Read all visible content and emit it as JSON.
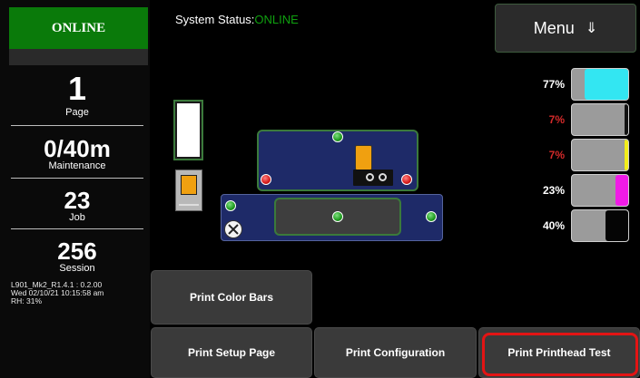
{
  "sidebar": {
    "online_label": "ONLINE",
    "page": {
      "value": "1",
      "label": "Page"
    },
    "maintenance": {
      "value": "0/40m",
      "label": "Maintenance"
    },
    "job": {
      "value": "23",
      "label": "Job"
    },
    "session": {
      "value": "256",
      "label": "Session"
    },
    "info": {
      "firmware": "L901_Mk2_R1.4.1 : 0.2.00",
      "datetime": "Wed 02/10/21 10:15:58 am",
      "humidity": "RH: 31%"
    }
  },
  "header": {
    "status_label": "System Status:",
    "status_value": "ONLINE",
    "menu_label": "Menu",
    "menu_icon": "⇓"
  },
  "ink_levels": [
    {
      "name": "cyan",
      "percent": "77%",
      "level": 0.77,
      "color": "#33e6f2",
      "text_color": "#ffffff"
    },
    {
      "name": "black",
      "percent": "7%",
      "level": 0.07,
      "color": "#111111",
      "text_color": "#d42a2a"
    },
    {
      "name": "yellow",
      "percent": "7%",
      "level": 0.07,
      "color": "#f2ee1a",
      "text_color": "#d42a2a"
    },
    {
      "name": "magenta",
      "percent": "23%",
      "level": 0.23,
      "color": "#f01be6",
      "text_color": "#ffffff"
    },
    {
      "name": "black",
      "percent": "40%",
      "level": 0.4,
      "color": "#050505",
      "text_color": "#ffffff"
    }
  ],
  "buttons": {
    "print_color_bars": "Print Color Bars",
    "print_setup_page": "Print Setup Page",
    "print_configuration": "Print Configuration",
    "print_printhead_test": "Print Printhead Test"
  },
  "colors": {
    "online_green": "#0a7a0a",
    "panel_blue": "#1e2a68",
    "highlight_red": "#e31414"
  }
}
